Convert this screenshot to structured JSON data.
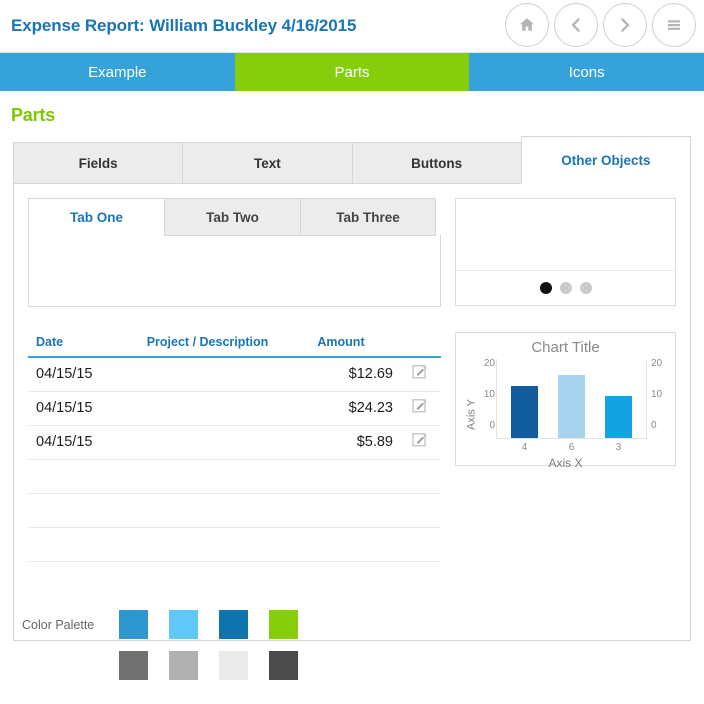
{
  "header": {
    "title": "Expense Report: William Buckley 4/16/2015",
    "nav_buttons": [
      {
        "name": "home-button",
        "icon": "home-icon"
      },
      {
        "name": "back-button",
        "icon": "chevron-left-icon"
      },
      {
        "name": "forward-button",
        "icon": "chevron-right-icon"
      },
      {
        "name": "menu-button",
        "icon": "hamburger-menu-icon"
      }
    ]
  },
  "main_tabs": [
    {
      "label": "Example",
      "active": false
    },
    {
      "label": "Parts",
      "active": true
    },
    {
      "label": "Icons",
      "active": false
    }
  ],
  "page": {
    "heading": "Parts"
  },
  "segmented_tabs": [
    {
      "label": "Fields",
      "active": false
    },
    {
      "label": "Text",
      "active": false
    },
    {
      "label": "Buttons",
      "active": false
    },
    {
      "label": "Other Objects",
      "active": true
    }
  ],
  "inner_tabs": [
    {
      "label": "Tab One",
      "active": true
    },
    {
      "label": "Tab Two",
      "active": false
    },
    {
      "label": "Tab Three",
      "active": false
    }
  ],
  "table": {
    "columns": [
      "Date",
      "Project / Description",
      "Amount",
      ""
    ],
    "rows": [
      {
        "date": "04/15/15",
        "description": "",
        "amount": "$12.69",
        "action": "edit-icon"
      },
      {
        "date": "04/15/15",
        "description": "",
        "amount": "$24.23",
        "action": "edit-icon"
      },
      {
        "date": "04/15/15",
        "description": "",
        "amount": "$5.89",
        "action": "edit-icon"
      }
    ],
    "empty_row_count": 3
  },
  "carousel": {
    "dot_count": 3,
    "active_dot_index": 0,
    "active_dot_color": "#111111",
    "inactive_dot_color": "#cbcbcb"
  },
  "chart_data": {
    "type": "bar",
    "title": "Chart Title",
    "xlabel": "Axis X",
    "ylabel": "Axis Y",
    "categories": [
      "4",
      "6",
      "3"
    ],
    "values": [
      15,
      18,
      12
    ],
    "colors": [
      "#115d9e",
      "#a9d2ef",
      "#13a3e0"
    ],
    "ylim": [
      0,
      20
    ],
    "yticks": [
      0,
      10,
      20
    ],
    "right_axis_ticks": [
      0,
      10,
      20
    ],
    "grid": false,
    "legend": false
  },
  "palette": {
    "label": "Color Palette",
    "row1": [
      "#2f97d0",
      "#5fc8f7",
      "#0f74ab",
      "#86ce0b"
    ],
    "row2": [
      "#717171",
      "#b0b0b0",
      "#eaeaea",
      "#4b4b4b"
    ]
  },
  "theme": {
    "brand_blue": "#1a75b5",
    "tab_blue": "#35a3da",
    "accent_green": "#86ce0b",
    "heading_green": "#7ec700"
  }
}
